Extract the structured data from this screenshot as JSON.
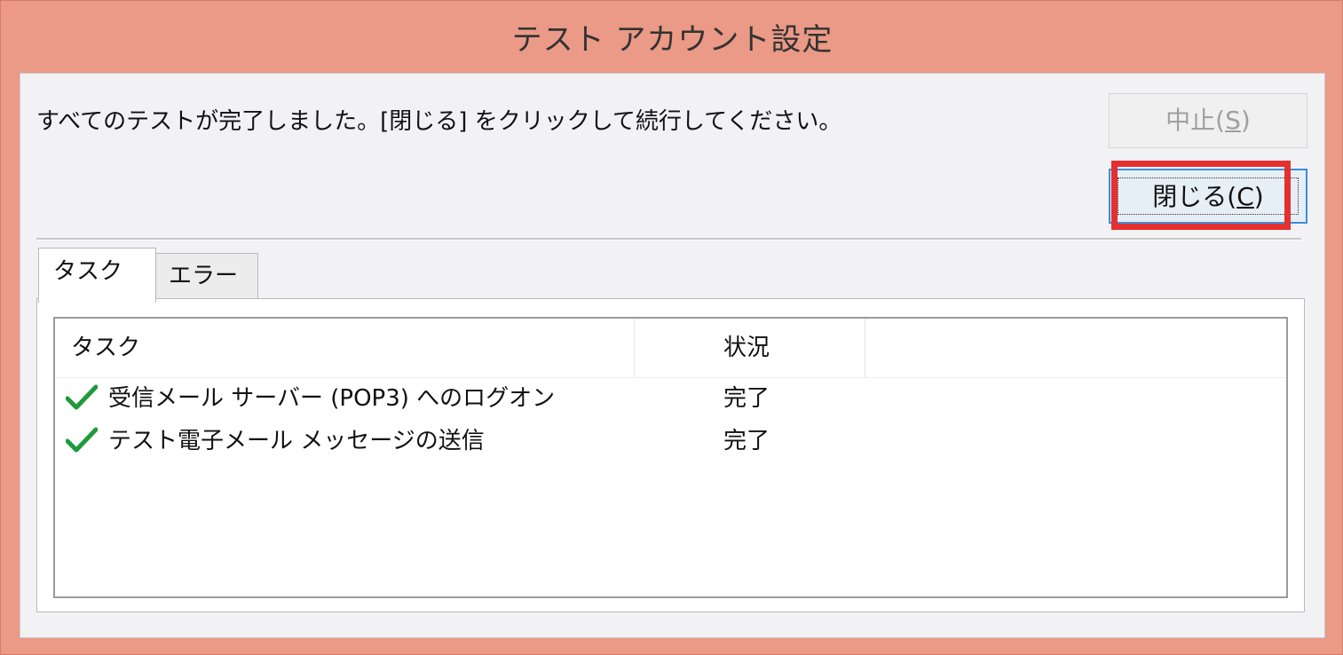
{
  "window": {
    "title": "テスト アカウント設定",
    "title_bar_color": "#ea9a86",
    "highlight_color": "#e53030"
  },
  "message": "すべてのテストが完了しました。[閉じる] をクリックして続行してください。",
  "buttons": {
    "stop": {
      "label": "中止(",
      "mnemonic": "S",
      "suffix": ")",
      "enabled": false
    },
    "close": {
      "label": "閉じる(",
      "mnemonic": "C",
      "suffix": ")",
      "enabled": true,
      "highlighted": true
    }
  },
  "tabs": [
    {
      "label": "タスク",
      "active": true
    },
    {
      "label": "エラー",
      "active": false
    }
  ],
  "table": {
    "columns": [
      "タスク",
      "状況",
      ""
    ],
    "rows": [
      {
        "icon": "checkmark-icon",
        "task": "受信メール サーバー (POP3) へのログオン",
        "status": "完了"
      },
      {
        "icon": "checkmark-icon",
        "task": "テスト電子メール メッセージの送信",
        "status": "完了"
      }
    ]
  }
}
